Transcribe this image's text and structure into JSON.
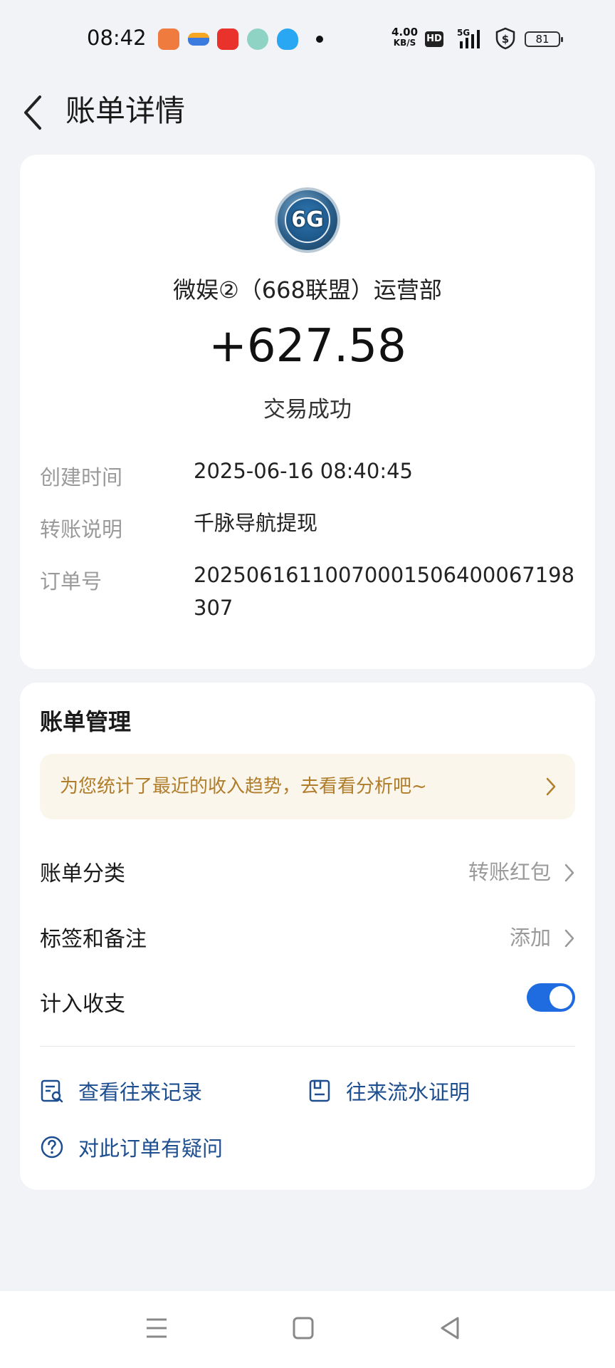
{
  "status_bar": {
    "time": "08:42",
    "net_speed_value": "4.00",
    "net_speed_unit": "KB/S",
    "hd": "HD",
    "network": "5G",
    "battery": "81"
  },
  "header": {
    "title": "账单详情",
    "back_icon": "chevron-left-icon"
  },
  "transaction": {
    "avatar_text": "6G",
    "payer": "微娱②（668联盟）运营部",
    "amount": "+627.58",
    "status": "交易成功",
    "details": [
      {
        "label": "创建时间",
        "value": "2025-06-16 08:40:45"
      },
      {
        "label": "转账说明",
        "value": "千脉导航提现"
      },
      {
        "label": "订单号",
        "value": "20250616110070001506400067198307"
      }
    ]
  },
  "management": {
    "title": "账单管理",
    "banner_text": "为您统计了最近的收入趋势，去看看分析吧~",
    "rows": [
      {
        "label": "账单分类",
        "value": "转账红包"
      },
      {
        "label": "标签和备注",
        "value": "添加"
      },
      {
        "label": "计入收支",
        "toggle": true
      }
    ],
    "actions": {
      "records": "查看往来记录",
      "statement": "往来流水证明",
      "question": "对此订单有疑问"
    }
  },
  "colors": {
    "accent": "#1f6ce0",
    "link": "#1d4e8f",
    "banner_bg": "#fbf6ec",
    "banner_text": "#b07d2a",
    "background": "#f2f3f7"
  }
}
